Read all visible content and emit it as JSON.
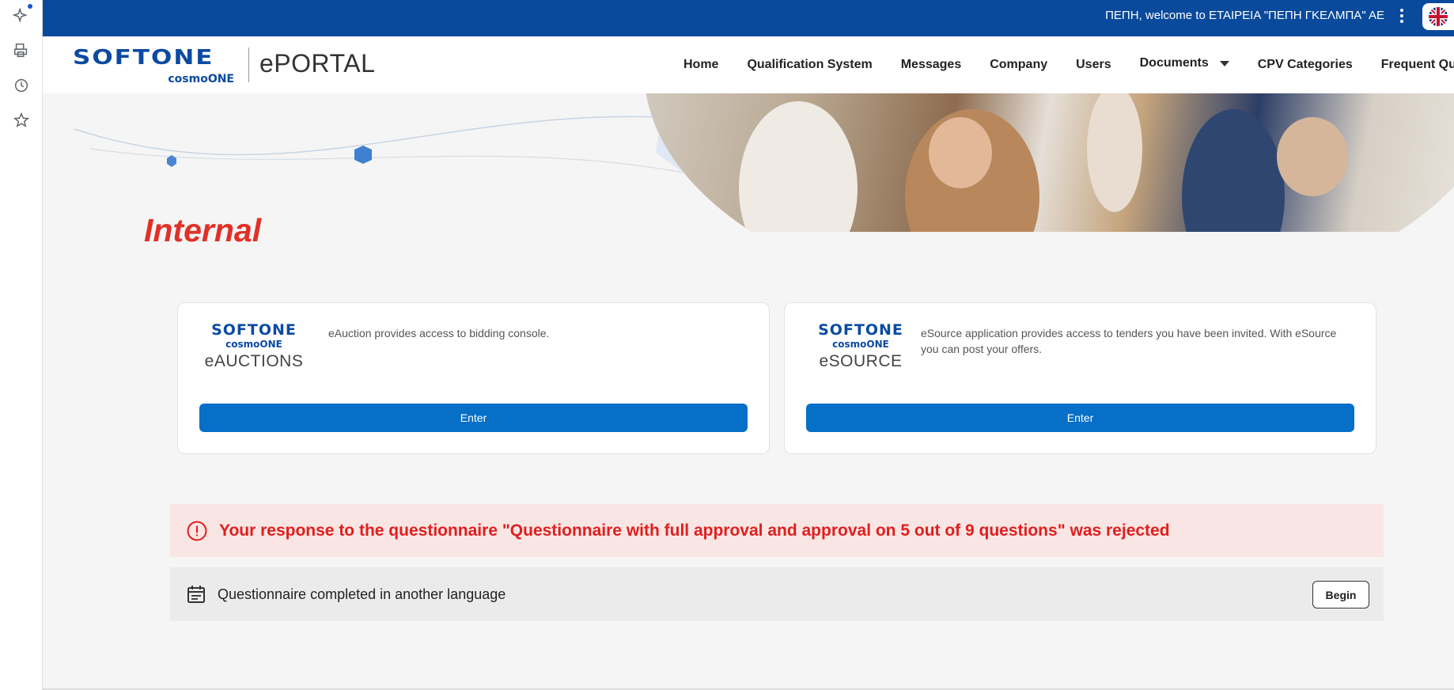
{
  "topbar": {
    "welcome": "ΠΕΠΗ, welcome to ΕΤΑΙΡΕΙΑ \"ΠΕΠΗ ΓΚΕΛΜΠΑ\" ΑΕ"
  },
  "header": {
    "brand": "SOFTONE",
    "brand_sub": "cosmoONE",
    "portal": "ePORTAL",
    "nav": [
      {
        "label": "Home"
      },
      {
        "label": "Qualification System"
      },
      {
        "label": "Messages"
      },
      {
        "label": "Company"
      },
      {
        "label": "Users"
      },
      {
        "label": "Documents"
      },
      {
        "label": "CPV Categories"
      },
      {
        "label": "Frequent Que"
      }
    ]
  },
  "main": {
    "title": "Internal",
    "cards": [
      {
        "brand": "SOFTONE",
        "brand_sub": "cosmoONE",
        "product": "eAUCTIONS",
        "description": "eAuction provides access to bidding console.",
        "button": "Enter"
      },
      {
        "brand": "SOFTONE",
        "brand_sub": "cosmoONE",
        "product": "eSOURCE",
        "description": "eSource application provides access to tenders you have been invited. With eSource you can post your offers.",
        "button": "Enter"
      }
    ],
    "alert_error": "Your response to the questionnaire \"Questionnaire with full approval and approval on 5 out of 9 questions\" was rejected",
    "alert_info": {
      "text": "Questionnaire completed in another language",
      "button": "Begin"
    }
  },
  "colors": {
    "topbar": "#0a4a9c",
    "brand": "#0b4aa3",
    "primary_button": "#066fc7",
    "title_red": "#e03127",
    "error_text": "#e01e1e",
    "error_bg": "#f9e6e4"
  },
  "icons": [
    "sparkle-icon",
    "printer-icon",
    "history-icon",
    "star-icon",
    "uk-flag-icon",
    "kebab-menu-icon",
    "alert-circle-icon",
    "calendar-list-icon",
    "chevron-down-icon"
  ]
}
